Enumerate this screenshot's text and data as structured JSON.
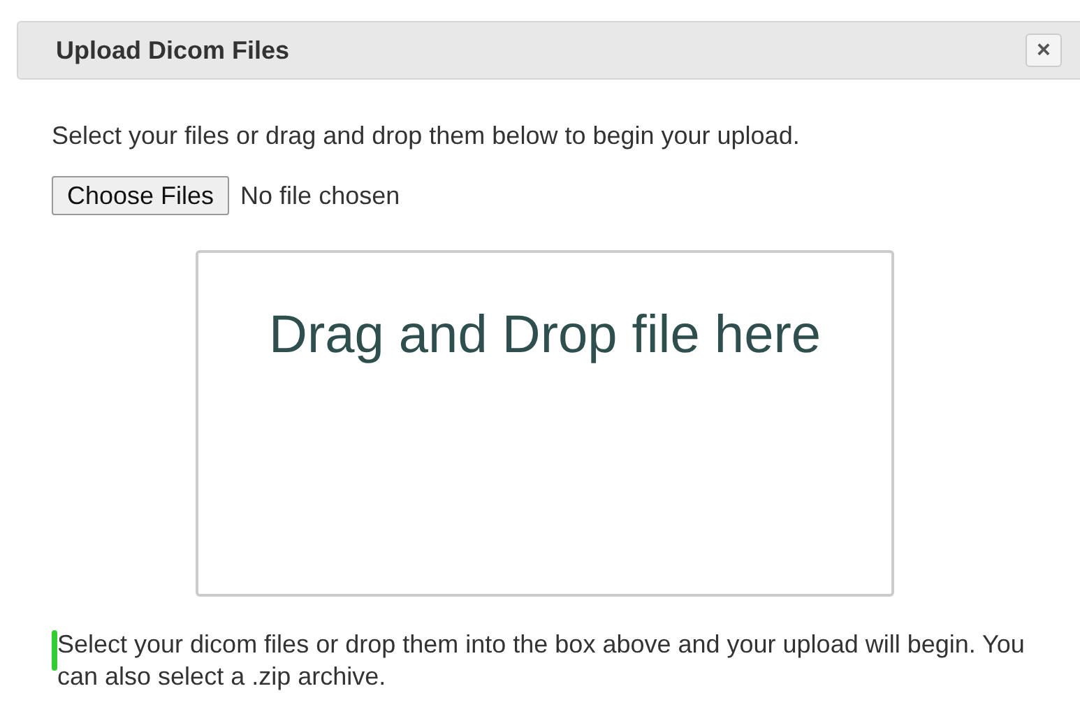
{
  "dialog": {
    "title": "Upload Dicom Files",
    "close_label": "×"
  },
  "intro": "Select your files or drag and drop them below to begin your upload.",
  "file_input": {
    "button": "Choose Files",
    "status": "No file chosen"
  },
  "drop_zone": {
    "label": "Drag and Drop file here"
  },
  "help_text": "Select your dicom files or drop them into the box above and your upload will begin. You can also select a .zip archive."
}
